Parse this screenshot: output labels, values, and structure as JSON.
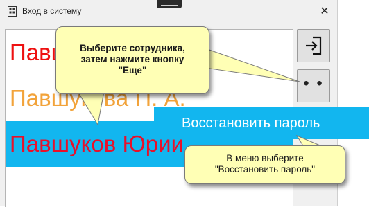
{
  "window": {
    "title": "Вход в систему",
    "close_glyph": "✕"
  },
  "users": [
    {
      "name": "Павшуков Ю. А."
    },
    {
      "name": "Павшукова П. А."
    },
    {
      "name": "Павшуков Юрий"
    }
  ],
  "buttons": {
    "login_icon": "login-icon",
    "more_label": "• • •"
  },
  "menu": {
    "items": [
      {
        "label": "Восстановить пароль"
      }
    ]
  },
  "tooltips": [
    {
      "lines": [
        "Выберите сотрудника,",
        "затем нажмите кнопку",
        "\"Еще\""
      ]
    },
    {
      "lines": [
        "В меню выберите",
        "\"Восстановить пароль\""
      ]
    }
  ],
  "colors": {
    "selection": "#12b6ef",
    "user_red": "#ee1111",
    "user_orange": "#f2a33a",
    "tooltip_bg": "#ffffb5"
  }
}
